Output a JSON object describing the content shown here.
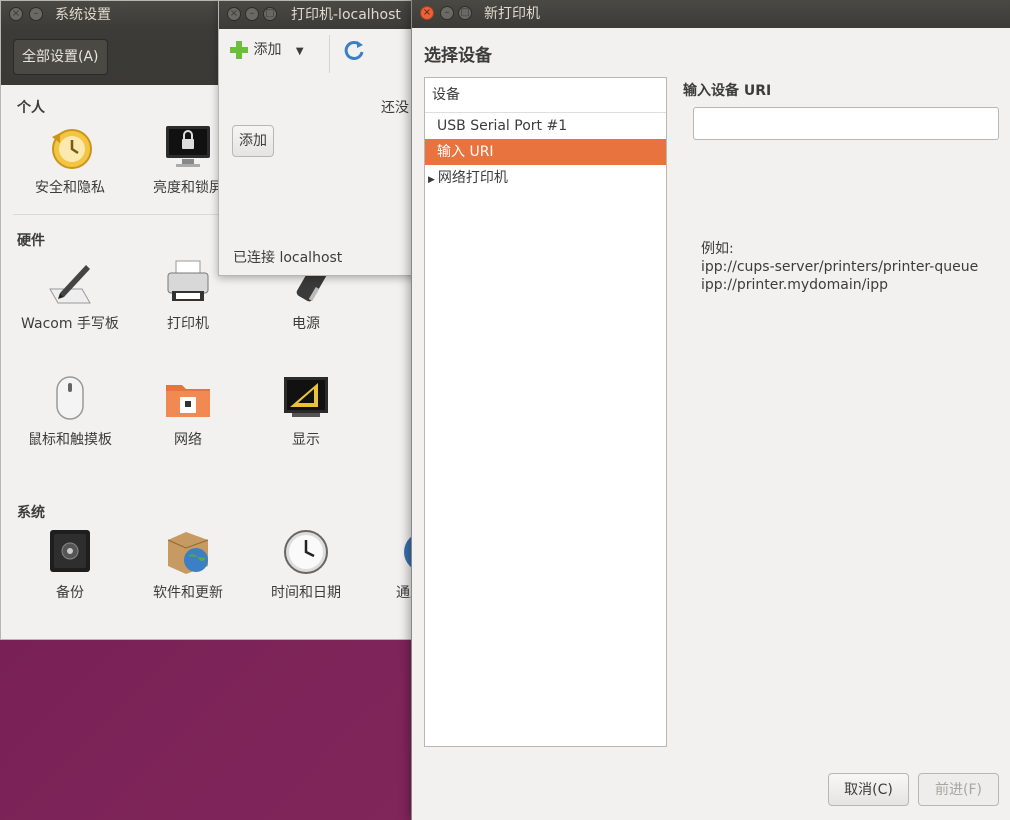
{
  "settings_window": {
    "title": "系统设置",
    "all_settings_label": "全部设置(A)",
    "sections": [
      {
        "title": "个人",
        "items": [
          "安全和隐私",
          "亮度和锁屏"
        ]
      },
      {
        "title": "硬件",
        "items": [
          "Wacom 手写板",
          "打印机",
          "电源",
          "鼠标和触摸板",
          "网络",
          "显示"
        ]
      },
      {
        "title": "系统",
        "items": [
          "备份",
          "软件和更新",
          "时间和日期",
          "通用辅助"
        ]
      }
    ]
  },
  "printers_window": {
    "title": "打印机-localhost",
    "add_tool_label": "添加",
    "partial_text": "还没",
    "add_button_label": "添加",
    "status": "已连接 localhost"
  },
  "new_printer_dialog": {
    "title": "新打印机",
    "heading": "选择设备",
    "device_list": {
      "header": "设备",
      "rows": [
        "USB Serial Port #1",
        "输入 URI",
        "网络打印机"
      ]
    },
    "uri_label": "输入设备 URI",
    "uri_value": "",
    "example_title": "例如:",
    "examples": [
      "ipp://cups-server/printers/printer-queue",
      "ipp://printer.mydomain/ipp"
    ],
    "cancel_label": "取消(C)",
    "forward_label": "前进(F)"
  },
  "colors": {
    "accent": "#e8733f",
    "titlebar": "#3c3b37",
    "desktop": "#7a2258"
  }
}
